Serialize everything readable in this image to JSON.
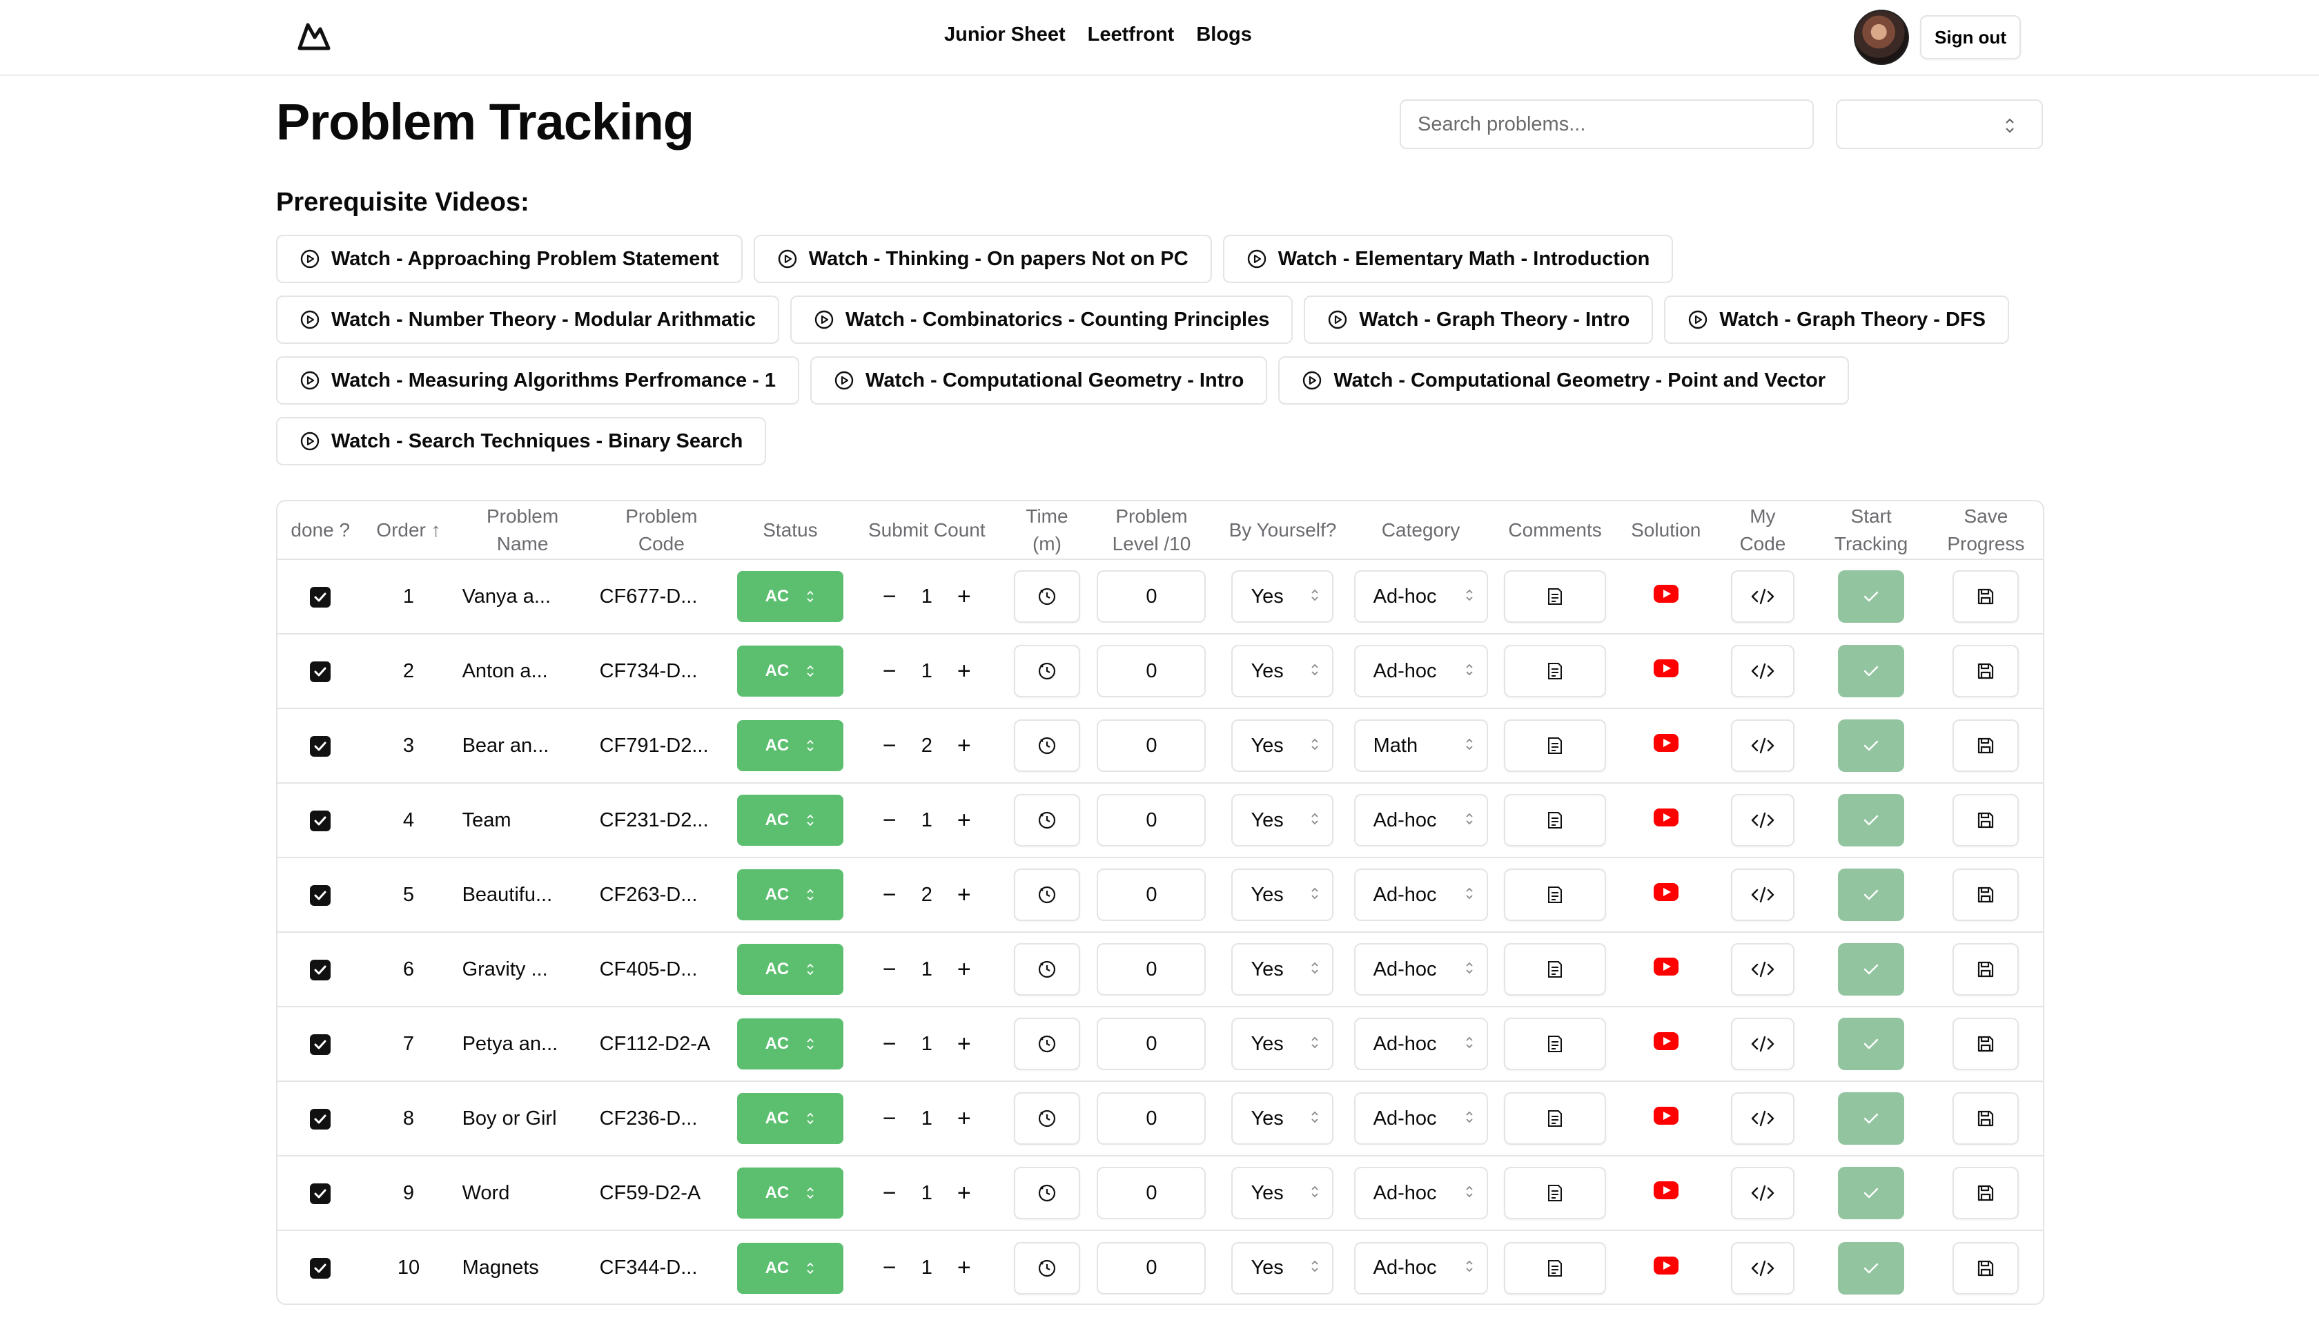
{
  "nav": {
    "items": [
      "Junior Sheet",
      "Leetfront",
      "Blogs"
    ],
    "signout": "Sign out"
  },
  "page": {
    "title": "Problem Tracking"
  },
  "search": {
    "placeholder": "Search problems..."
  },
  "prereq": {
    "title": "Prerequisite Videos:",
    "rows": [
      [
        "Watch - Approaching Problem Statement",
        "Watch - Thinking - On papers Not on PC",
        "Watch - Elementary Math - Introduction"
      ],
      [
        "Watch - Number Theory - Modular Arithmatic",
        "Watch - Combinatorics - Counting Principles",
        "Watch - Graph Theory - Intro",
        "Watch - Graph Theory - DFS"
      ],
      [
        "Watch - Measuring Algorithms Perfromance - 1",
        "Watch - Computational Geometry - Intro",
        "Watch - Computational Geometry - Point and Vector"
      ],
      [
        "Watch - Search Techniques - Binary Search"
      ]
    ]
  },
  "table": {
    "headers": [
      "done ?",
      "Order ↑",
      "Problem Name",
      "Problem Code",
      "Status",
      "Submit Count",
      "Time (m)",
      "Problem Level /10",
      "By Yourself?",
      "Category",
      "Comments",
      "Solution",
      "My Code",
      "Start Tracking",
      "Save Progress"
    ],
    "rows": [
      {
        "order": "1",
        "name": "Vanya a...",
        "code": "CF677-D...",
        "status": "AC",
        "count": "1",
        "level": "0",
        "by": "Yes",
        "category": "Ad-hoc"
      },
      {
        "order": "2",
        "name": "Anton a...",
        "code": "CF734-D...",
        "status": "AC",
        "count": "1",
        "level": "0",
        "by": "Yes",
        "category": "Ad-hoc"
      },
      {
        "order": "3",
        "name": "Bear an...",
        "code": "CF791-D2...",
        "status": "AC",
        "count": "2",
        "level": "0",
        "by": "Yes",
        "category": "Math"
      },
      {
        "order": "4",
        "name": "Team",
        "code": "CF231-D2...",
        "status": "AC",
        "count": "1",
        "level": "0",
        "by": "Yes",
        "category": "Ad-hoc"
      },
      {
        "order": "5",
        "name": "Beautifu...",
        "code": "CF263-D...",
        "status": "AC",
        "count": "2",
        "level": "0",
        "by": "Yes",
        "category": "Ad-hoc"
      },
      {
        "order": "6",
        "name": "Gravity ...",
        "code": "CF405-D...",
        "status": "AC",
        "count": "1",
        "level": "0",
        "by": "Yes",
        "category": "Ad-hoc"
      },
      {
        "order": "7",
        "name": "Petya an...",
        "code": "CF112-D2-A",
        "status": "AC",
        "count": "1",
        "level": "0",
        "by": "Yes",
        "category": "Ad-hoc"
      },
      {
        "order": "8",
        "name": "Boy or Girl",
        "code": "CF236-D...",
        "status": "AC",
        "count": "1",
        "level": "0",
        "by": "Yes",
        "category": "Ad-hoc"
      },
      {
        "order": "9",
        "name": "Word",
        "code": "CF59-D2-A",
        "status": "AC",
        "count": "1",
        "level": "0",
        "by": "Yes",
        "category": "Ad-hoc"
      },
      {
        "order": "10",
        "name": "Magnets",
        "code": "CF344-D...",
        "status": "AC",
        "count": "1",
        "level": "0",
        "by": "Yes",
        "category": "Ad-hoc"
      }
    ]
  },
  "colors": {
    "status_ac": "#5cbf6f",
    "track": "#93c4a0",
    "youtube": "#ff0000"
  }
}
